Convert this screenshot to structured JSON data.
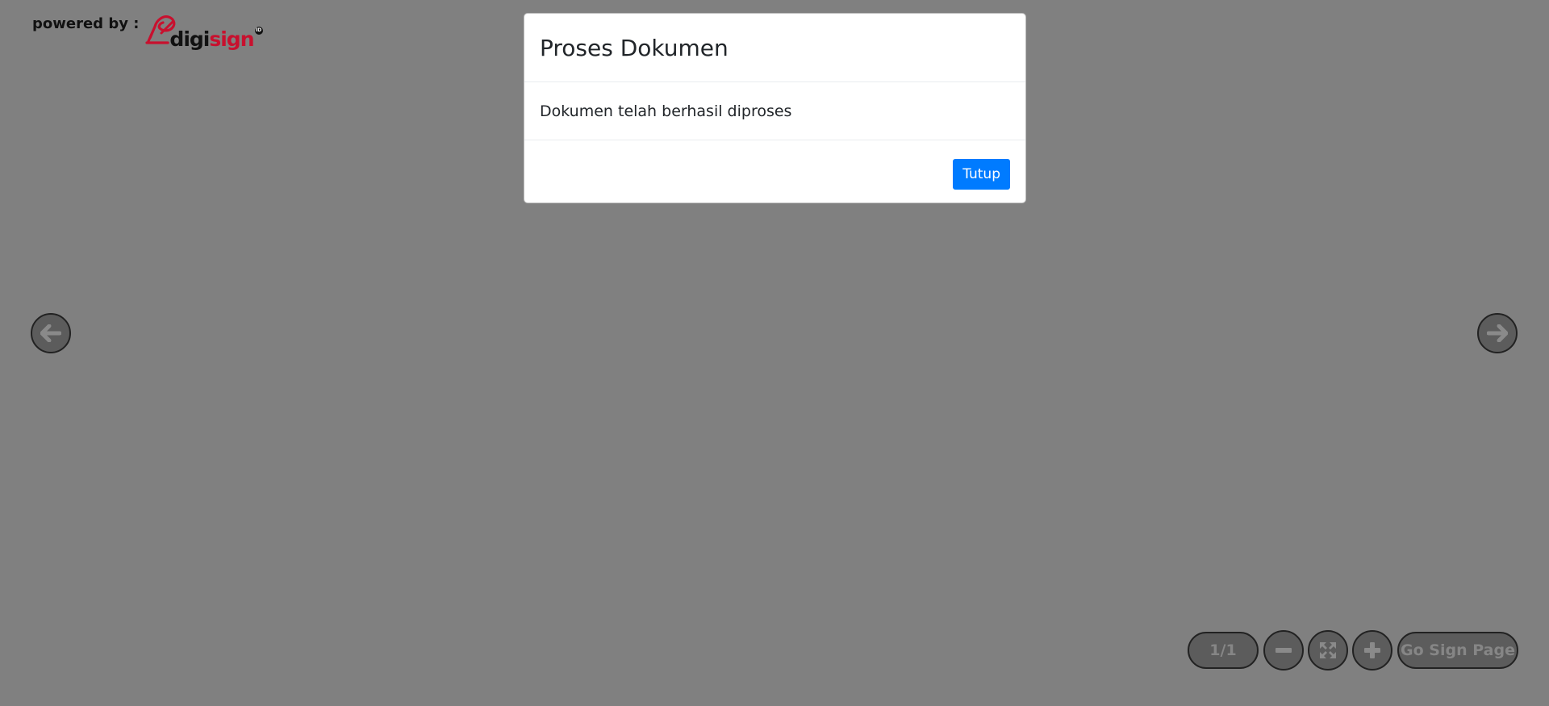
{
  "branding": {
    "label": "powered by :",
    "logo_part1": "digi",
    "logo_part2": "sign",
    "logo_badge": "ID",
    "logo_color_dark": "#111111",
    "logo_color_accent": "#c8102e"
  },
  "viewer": {
    "background": "#808080",
    "prev_icon": "arrow-left-icon",
    "next_icon": "arrow-right-icon"
  },
  "toolbar": {
    "page_indicator": "1/1",
    "zoom_out_icon": "minus-icon",
    "fit_icon": "expand-icon",
    "zoom_in_icon": "plus-icon",
    "go_sign_label": "Go Sign Page"
  },
  "modal": {
    "title": "Proses Dokumen",
    "message": "Dokumen telah berhasil diproses",
    "close_label": "Tutup",
    "button_color": "#007bff"
  }
}
